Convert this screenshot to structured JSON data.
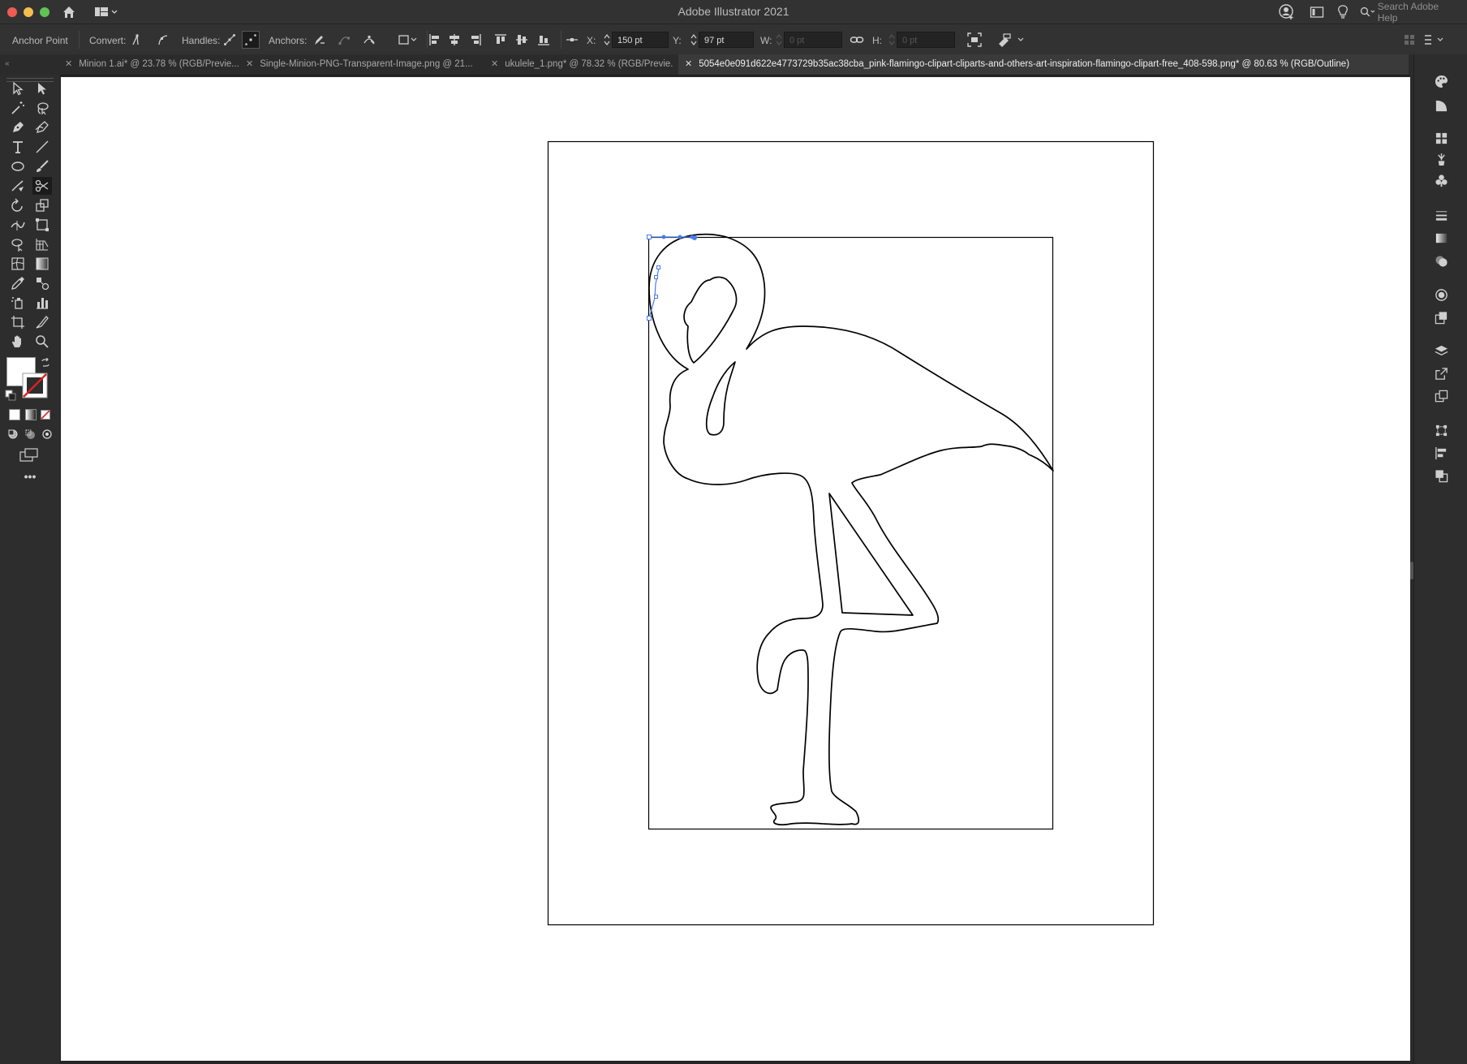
{
  "app": {
    "title": "Adobe Illustrator 2021",
    "search_placeholder": "Search Adobe Help"
  },
  "controlbar": {
    "tool_name": "Anchor Point",
    "convert_label": "Convert:",
    "handles_label": "Handles:",
    "anchors_label": "Anchors:",
    "x_label": "X:",
    "x_value": "150 pt",
    "y_label": "Y:",
    "y_value": "97 pt",
    "w_label": "W:",
    "w_value": "0 pt",
    "h_label": "H:",
    "h_value": "0 pt"
  },
  "tabs": [
    {
      "label": "Minion 1.ai* @ 23.78 % (RGB/Previe..."
    },
    {
      "label": "Single-Minion-PNG-Transparent-Image.png @ 21..."
    },
    {
      "label": "ukulele_1.png* @ 78.32 % (RGB/Previe..."
    },
    {
      "label": "5054e0e091d622e4773729b35ac38cba_pink-flamingo-clipart-cliparts-and-others-art-inspiration-flamingo-clipart-free_408-598.png* @ 80.63 % (RGB/Outline)"
    }
  ],
  "colors": {
    "selection": "#4a7be8",
    "outline": "#000000",
    "ui_dark": "#262626",
    "ui_panel": "#323232",
    "close": "#ee5c54",
    "minimize": "#f5bc4f",
    "maximize": "#5fc454"
  },
  "icons": {
    "home": "home-icon",
    "workspace": "workspace-switcher-icon",
    "more_tools": "more-tools-icon"
  }
}
